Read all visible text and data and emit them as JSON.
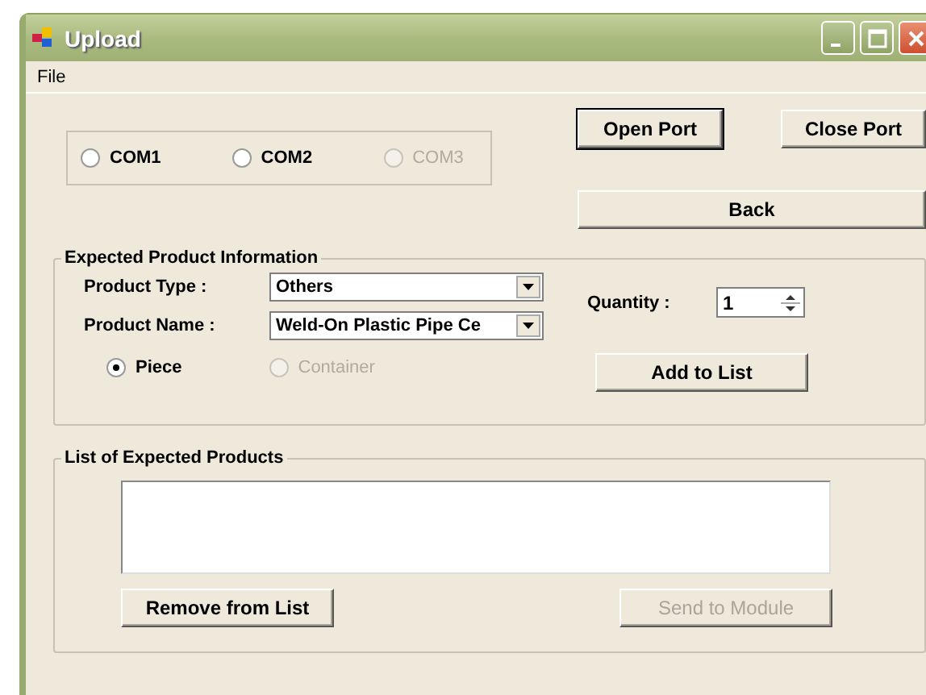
{
  "window": {
    "title": "Upload"
  },
  "menu": [
    "File"
  ],
  "ports": [
    {
      "label": "COM1",
      "selected": false,
      "disabled": false
    },
    {
      "label": "COM2",
      "selected": false,
      "disabled": false
    },
    {
      "label": "COM3",
      "selected": false,
      "disabled": true
    }
  ],
  "port_buttons": [
    {
      "label": "Open Port",
      "focused": true,
      "disabled": false
    },
    {
      "label": "Close Port",
      "focused": false,
      "disabled": false
    }
  ],
  "back_button": {
    "label": "Back",
    "disabled": false
  },
  "product_info": {
    "title": "Expected Product Information",
    "product_type": {
      "label": "Product Type :",
      "value": "Others"
    },
    "product_name": {
      "label": "Product Name :",
      "value": "Weld-On Plastic Pipe Ce"
    },
    "quantity": {
      "label": "Quantity :",
      "value": "1"
    },
    "units": [
      {
        "label": "Piece",
        "selected": true,
        "disabled": false
      },
      {
        "label": "Container",
        "selected": false,
        "disabled": true
      }
    ],
    "add_button": {
      "label": "Add to List",
      "disabled": false
    }
  },
  "product_list": {
    "title": "List of Expected Products",
    "buttons": [
      {
        "label": "Remove from List",
        "disabled": false
      },
      {
        "label": "Send to Module",
        "disabled": true
      }
    ]
  }
}
